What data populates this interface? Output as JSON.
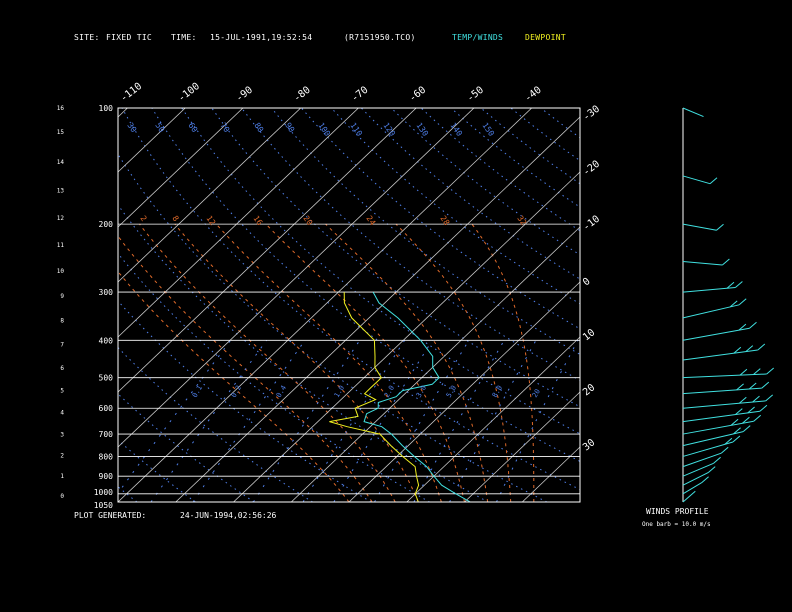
{
  "header": {
    "site_label": "SITE:",
    "site_value": "FIXED TIC",
    "time_label": "TIME:",
    "time_value": "15-JUL-1991,19:52:54",
    "file": "(R7151950.TCO)",
    "temp_winds_label": "TEMP/WINDS",
    "dewpoint_label": "DEWPOINT"
  },
  "footer": {
    "generated_label": "PLOT GENERATED:",
    "generated_value": "24-JUN-1994,02:56:26"
  },
  "winds_profile": {
    "title": "WINDS PROFILE",
    "note": "One barb = 10.0 m/s"
  },
  "colors": {
    "background": "#000000",
    "axes": "#ffffff",
    "isotherms": "#c8c8c8",
    "mixing_ratio": "#4f7fe8",
    "dry_adiabat": "#4f7fe8",
    "moist_adiabat": "#e06a2a",
    "temperature": "#40e0e0",
    "dewpoint": "#f0f020",
    "wind": "#40e0e0"
  },
  "chart_data": {
    "type": "line",
    "pressure_levels": [
      "100",
      "200",
      "300",
      "400",
      "500",
      "600",
      "700",
      "800",
      "900",
      "1000",
      "1050"
    ],
    "height_ticks_km": [
      "0",
      "1",
      "2",
      "3",
      "4",
      "5",
      "6",
      "7",
      "8",
      "9",
      "10",
      "11",
      "12",
      "13",
      "14",
      "15",
      "16"
    ],
    "isotherm_top_labels": [
      "-110",
      "-100",
      "-90",
      "-80",
      "-70",
      "-60",
      "-50",
      "-40"
    ],
    "isotherm_right_labels": [
      "-30",
      "-20",
      "-10",
      "0",
      "10",
      "20",
      "30"
    ],
    "dry_adiabat_labels": [
      "30",
      "50",
      "60",
      "70",
      "80",
      "90",
      "100",
      "110",
      "120",
      "130",
      "140",
      "150"
    ],
    "moist_adiabat_labels": [
      "2",
      "8",
      "12",
      "16",
      "20",
      "24",
      "28",
      "32"
    ],
    "mixing_ratio_labels": [
      "0.1",
      "0.2",
      "0.4",
      "1.0",
      "2.0",
      "3.0",
      "5.0",
      "8.0",
      "20"
    ],
    "series": [
      {
        "name": "TEMP/WINDS",
        "color": "#40e0e0",
        "points": [
          [
            1050,
            21
          ],
          [
            1000,
            17
          ],
          [
            950,
            13
          ],
          [
            900,
            10
          ],
          [
            850,
            7
          ],
          [
            800,
            3
          ],
          [
            750,
            -1
          ],
          [
            700,
            -5
          ],
          [
            670,
            -8
          ],
          [
            650,
            -12
          ],
          [
            620,
            -13
          ],
          [
            600,
            -12
          ],
          [
            580,
            -13
          ],
          [
            560,
            -11
          ],
          [
            540,
            -11
          ],
          [
            520,
            -7
          ],
          [
            500,
            -7
          ],
          [
            470,
            -10
          ],
          [
            440,
            -12
          ],
          [
            400,
            -17
          ],
          [
            350,
            -25
          ],
          [
            320,
            -31
          ],
          [
            300,
            -34
          ]
        ]
      },
      {
        "name": "DEWPOINT",
        "color": "#f0f020",
        "points": [
          [
            1050,
            12
          ],
          [
            1000,
            10
          ],
          [
            950,
            9
          ],
          [
            900,
            7
          ],
          [
            850,
            5
          ],
          [
            800,
            1
          ],
          [
            750,
            -3
          ],
          [
            700,
            -7
          ],
          [
            670,
            -14
          ],
          [
            650,
            -18
          ],
          [
            630,
            -14
          ],
          [
            600,
            -16
          ],
          [
            570,
            -14
          ],
          [
            550,
            -17
          ],
          [
            530,
            -17
          ],
          [
            500,
            -17
          ],
          [
            470,
            -20
          ],
          [
            440,
            -22
          ],
          [
            400,
            -25
          ],
          [
            350,
            -33
          ],
          [
            320,
            -37
          ],
          [
            300,
            -39
          ]
        ]
      }
    ],
    "winds": {
      "levels": [
        1050,
        1000,
        950,
        900,
        850,
        800,
        750,
        700,
        650,
        600,
        550,
        500,
        450,
        400,
        350,
        300,
        250,
        200,
        150,
        100
      ],
      "speed_ms": [
        3,
        5,
        8,
        10,
        13,
        18,
        22,
        26,
        28,
        30,
        28,
        30,
        27,
        24,
        20,
        16,
        10,
        8,
        6,
        4
      ],
      "direction_deg": [
        210,
        220,
        225,
        230,
        235,
        240,
        245,
        250,
        255,
        260,
        262,
        265,
        255,
        250,
        245,
        260,
        280,
        290,
        300,
        310
      ]
    },
    "xlabel": "",
    "ylabel": "",
    "ylim": [
      1050,
      100
    ],
    "xlim": [
      -40,
      40
    ],
    "grid": true,
    "legend": "top-right"
  }
}
